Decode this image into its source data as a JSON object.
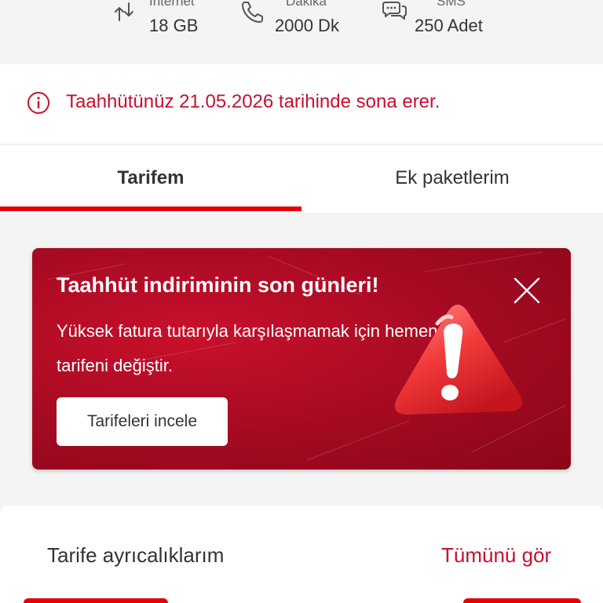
{
  "stats": [
    {
      "label": "İnternet",
      "value": "18 GB",
      "icon": "data-transfer-icon"
    },
    {
      "label": "Dakika",
      "value": "2000 Dk",
      "icon": "phone-icon"
    },
    {
      "label": "SMS",
      "value": "250 Adet",
      "icon": "chat-bubble-icon"
    }
  ],
  "notice": {
    "text": "Taahhütünüz 21.05.2026 tarihinde sona erer.",
    "icon": "info-icon"
  },
  "tabs": [
    {
      "label": "Tarifem",
      "active": true
    },
    {
      "label": "Ek paketlerim",
      "active": false
    }
  ],
  "promo": {
    "title": "Taahhüt indiriminin son günleri!",
    "description": "Yüksek fatura tutarıyla karşılaşmamak için hemen tarifeni değiştir.",
    "button_label": "Tarifeleri incele",
    "close_icon": "close-icon",
    "illustration_icon": "warning-triangle-icon"
  },
  "privileges": {
    "title": "Tarife ayrıcalıklarım",
    "link": "Tümünü gör"
  },
  "colors": {
    "accent": "#e60000",
    "notice_text": "#c8102e",
    "promo_bg": "#a30a22"
  }
}
